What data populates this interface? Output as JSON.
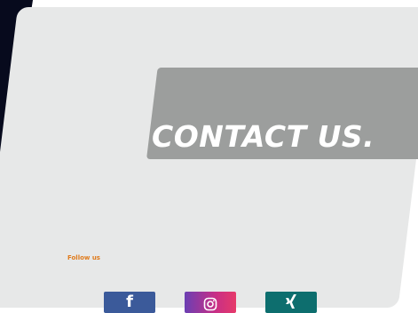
{
  "contact": {
    "title": "CONTACT US."
  },
  "social": {
    "label": "Follow us",
    "links": [
      {
        "name": "Facebook",
        "icon": "facebook-icon",
        "color": "#3b5a9a"
      },
      {
        "name": "Instagram",
        "icon": "instagram-icon",
        "color": "#c82f86"
      },
      {
        "name": "Xing",
        "icon": "xing-icon",
        "color": "#0d6e6e"
      }
    ]
  },
  "colors": {
    "card_background": "#e7e8e8",
    "banner": "#9c9e9d",
    "accent": "#e07b1c",
    "dark_panel": "#070a1d"
  }
}
